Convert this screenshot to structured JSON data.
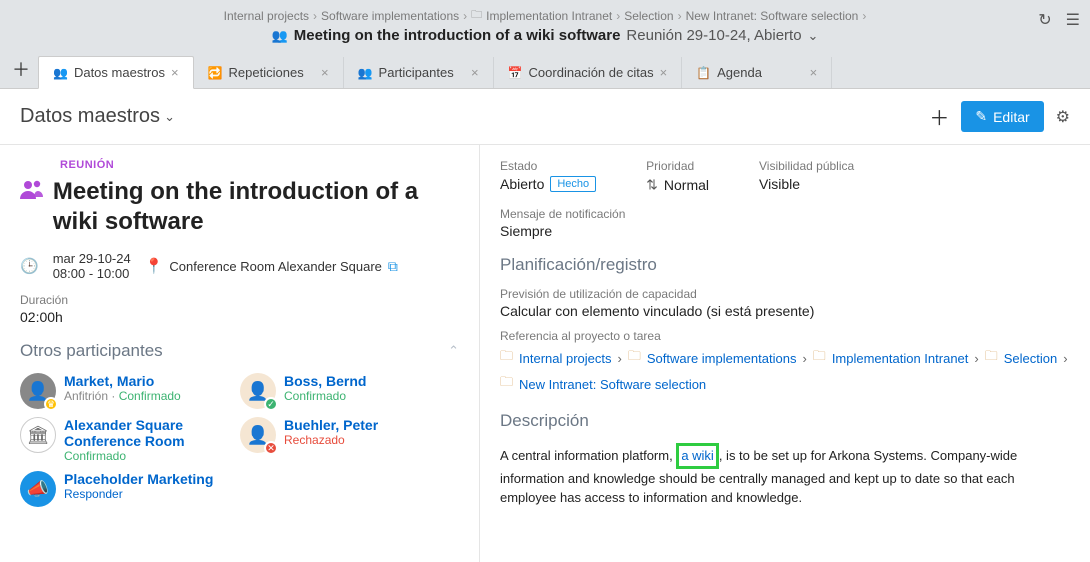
{
  "breadcrumb": [
    "Internal projects",
    "Software implementations",
    "Implementation Intranet",
    "Selection",
    "New Intranet: Software selection"
  ],
  "page_title": "Meeting on the introduction of a wiki software",
  "page_subtitle": "Reunión 29-10-24, Abierto",
  "tabs": [
    {
      "label": "Datos maestros",
      "active": true
    },
    {
      "label": "Repeticiones",
      "active": false
    },
    {
      "label": "Participantes",
      "active": false
    },
    {
      "label": "Coordinación de citas",
      "active": false
    },
    {
      "label": "Agenda",
      "active": false
    }
  ],
  "subheader_title": "Datos maestros",
  "edit_button": "Editar",
  "meeting": {
    "type_label": "REUNIÓN",
    "title": "Meeting on the introduction of a wiki software",
    "date": "mar 29-10-24",
    "time": "08:00 - 10:00",
    "location": "Conference Room Alexander Square",
    "duration_label": "Duración",
    "duration_value": "02:00h"
  },
  "other_participants_title": "Otros participantes",
  "participants": [
    {
      "name": "Market, Mario",
      "host_label": "Anfitrión",
      "status": "Confirmado",
      "status_class": "confirmed",
      "badge": "crown"
    },
    {
      "name": "Boss, Bernd",
      "status": "Confirmado",
      "status_class": "confirmed",
      "badge": "check"
    },
    {
      "name": "Alexander Square Conference Room",
      "status": "Confirmado",
      "status_class": "confirmed",
      "room": true
    },
    {
      "name": "Buehler, Peter",
      "status": "Rechazado",
      "status_class": "rejected",
      "badge": "cross"
    },
    {
      "name": "Placeholder Marketing",
      "status": "Responder",
      "status_class": "respond"
    }
  ],
  "status": {
    "estado_label": "Estado",
    "estado_value": "Abierto",
    "done_label": "Hecho",
    "prioridad_label": "Prioridad",
    "prioridad_value": "Normal",
    "visibilidad_label": "Visibilidad pública",
    "visibilidad_value": "Visible",
    "mensaje_label": "Mensaje de notificación",
    "mensaje_value": "Siempre"
  },
  "planning": {
    "title": "Planificación/registro",
    "prevision_label": "Previsión de utilización de capacidad",
    "prevision_value": "Calcular con elemento vinculado (si está presente)",
    "ref_label": "Referencia al proyecto o tarea",
    "ref_links": [
      "Internal projects",
      "Software implementations",
      "Implementation Intranet",
      "Selection",
      "New Intranet: Software selection"
    ]
  },
  "descripcion": {
    "title": "Descripción",
    "before": "A central information platform, ",
    "link": "a wiki",
    "after": ", is to be set up for Arkona Systems. Company-wide information and knowledge should be centrally managed and kept up to date so that each employee has access to information and knowledge."
  }
}
